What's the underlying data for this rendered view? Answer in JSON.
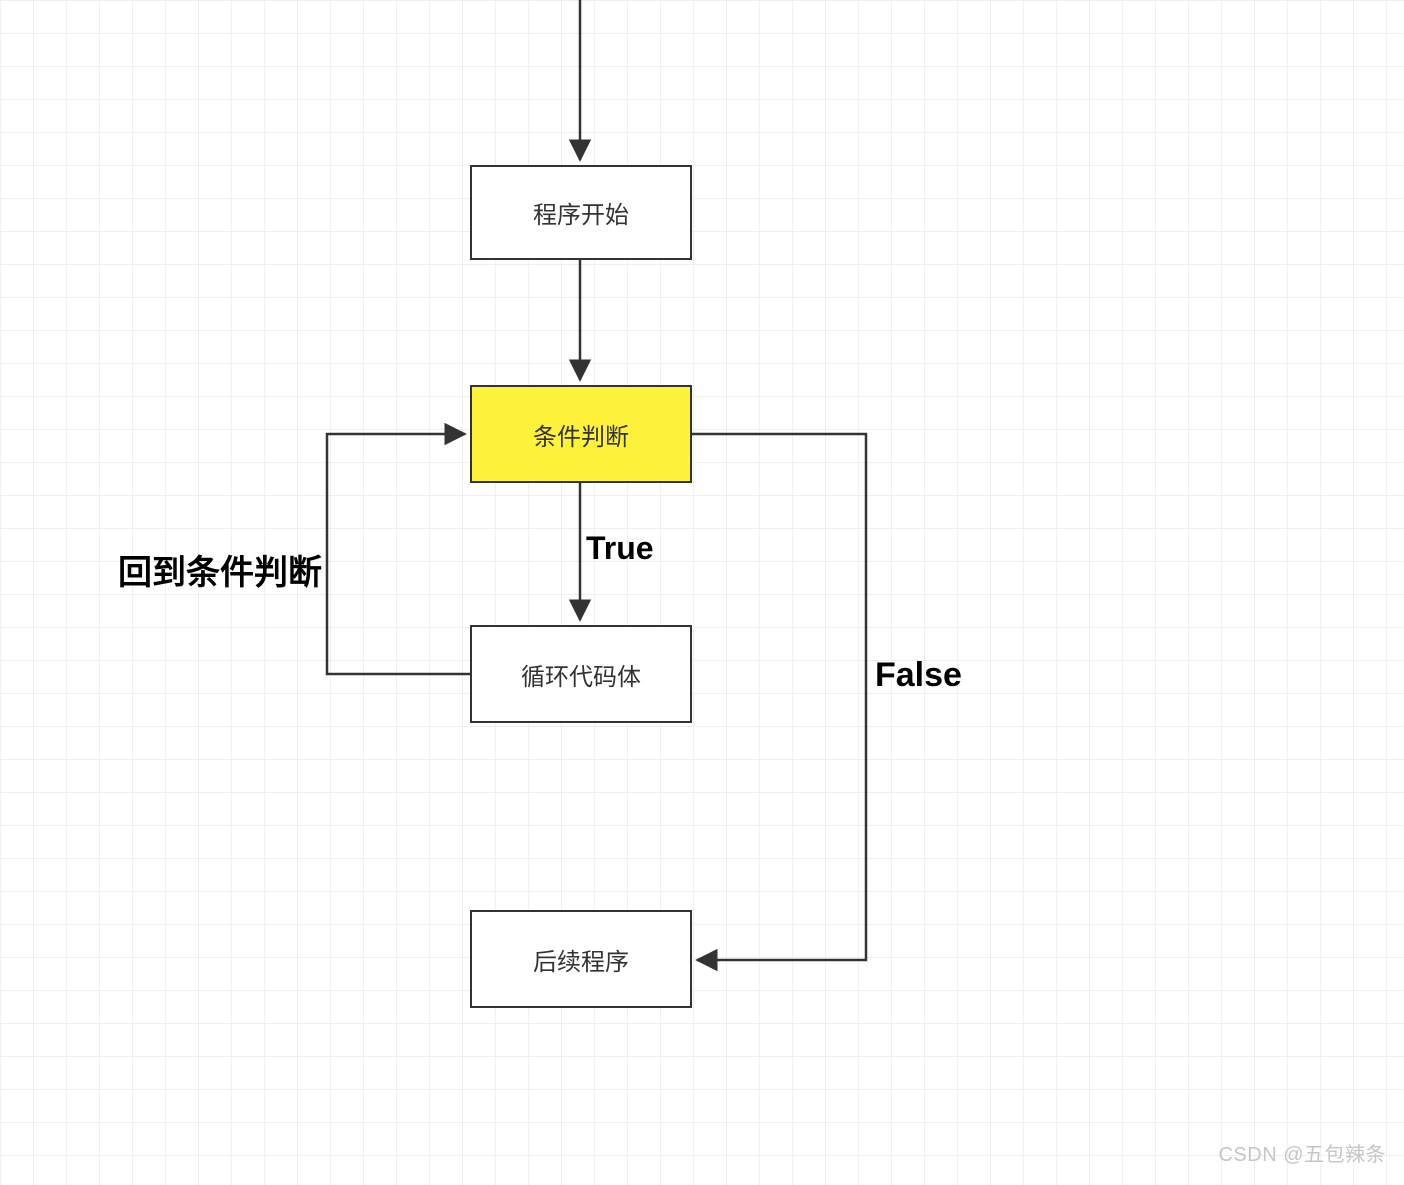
{
  "nodes": {
    "start": {
      "text": "程序开始"
    },
    "cond": {
      "text": "条件判断"
    },
    "loop": {
      "text": "循环代码体"
    },
    "after": {
      "text": "后续程序"
    }
  },
  "labels": {
    "true": "True",
    "false": "False",
    "back": "回到条件判断"
  },
  "watermark": "CSDN @五包辣条",
  "colors": {
    "highlight": "#fff23b",
    "stroke": "#333333"
  }
}
